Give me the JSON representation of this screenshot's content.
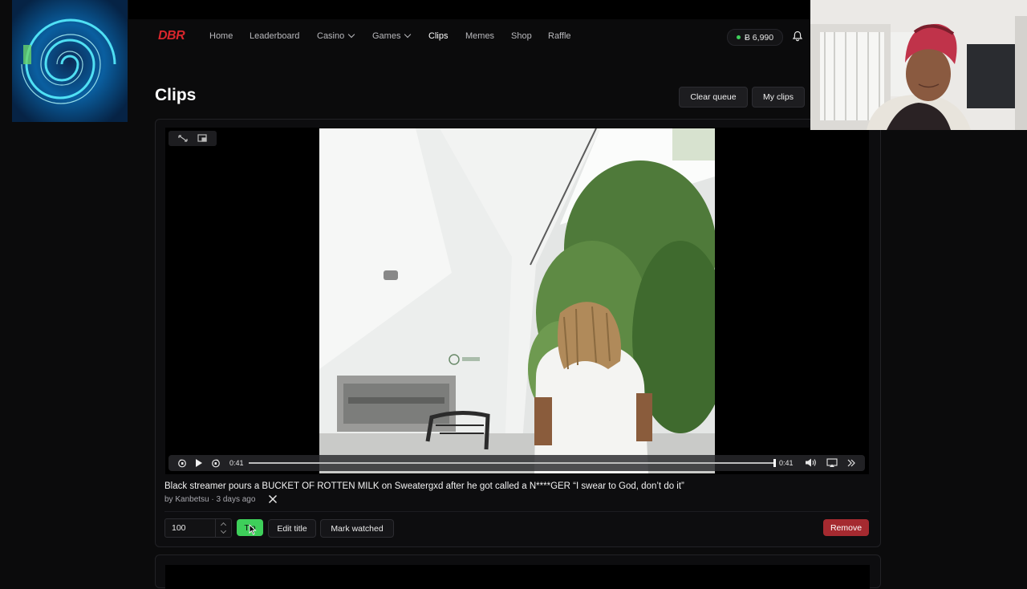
{
  "nav": {
    "logo": "DBR",
    "links": [
      "Home",
      "Leaderboard",
      "Casino",
      "Games",
      "Clips",
      "Memes",
      "Shop",
      "Raffle"
    ],
    "active": "Clips",
    "balance": "Ƀ 6,990"
  },
  "page": {
    "title": "Clips",
    "clear_queue": "Clear queue",
    "my_clips": "My clips"
  },
  "clip": {
    "title": "Black streamer pours a BUCKET OF ROTTEN MILK on Sweatergxd after he got called a N****GER “I swear to God, don’t do it”",
    "meta": "by Kanbetsu · 3 days ago",
    "current_time": "0:41",
    "duration": "0:41",
    "progress": 1.0,
    "tip_amount": "100",
    "tip_label": "Tip",
    "edit_title": "Edit title",
    "mark_watched": "Mark watched",
    "remove": "Remove"
  },
  "colors": {
    "accent_green": "#3ecf5a",
    "danger_red": "#a52a30",
    "logo_red": "#d9262c",
    "background": "#0b0b0c"
  }
}
